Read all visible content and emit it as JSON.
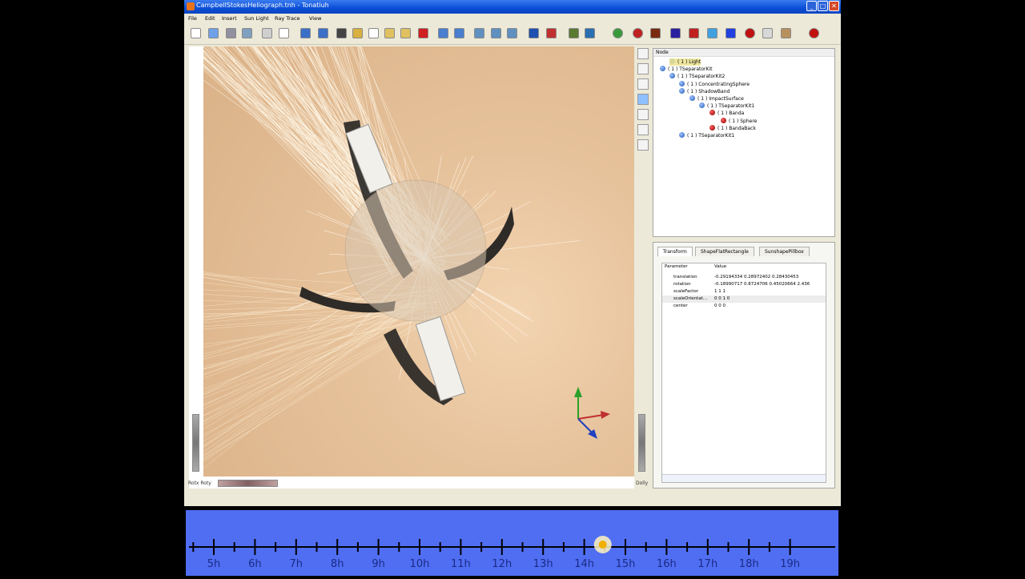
{
  "window": {
    "title": "CampbellStokesHeliograph.tnh - Tonatiuh"
  },
  "menu": [
    "File",
    "Edit",
    "Insert",
    "Sun Light",
    "Ray Trace",
    "View"
  ],
  "toolbar": {
    "icons": [
      "new-file-icon",
      "open-file-icon",
      "save-icon",
      "save-as-icon",
      "print-icon",
      "close-doc-icon",
      "undo-icon",
      "redo-icon",
      "arrow-down-icon",
      "cut-icon",
      "copy-icon",
      "paste-icon",
      "paste-link-icon",
      "delete-icon",
      "rotate-icon",
      "export-icon",
      "group-node-icon",
      "surface-node-icon",
      "material-node-icon",
      "separator-node-icon",
      "shape-node-icon",
      "tracker-icon",
      "tracker-alt-icon",
      "material-icon",
      "cone-icon",
      "cylinder-icon",
      "flat-rect-icon",
      "disk-icon",
      "parabolic-icon",
      "square-icon",
      "sphere-icon",
      "plane-icon",
      "box-icon",
      "run-ray-trace-icon"
    ]
  },
  "viewer": {
    "left_wheel_label": "Rotx Roty",
    "right_wheel_label": "Dolly"
  },
  "tree": {
    "header": "Node",
    "nodes": [
      {
        "label": "( 1 )  Light",
        "icon": "light"
      },
      {
        "label": "( 1 )  TSeparatorKit",
        "icon": "separator"
      },
      {
        "label": "( 1 )  TSeparatorKit2",
        "icon": "separator"
      },
      {
        "label": "( 1 )  ConcentratingSphere",
        "icon": "separator"
      },
      {
        "label": "( 1 )  ShadowBand",
        "icon": "separator"
      },
      {
        "label": "( 1 )  ImpactSurface",
        "icon": "separator"
      },
      {
        "label": "( 1 )  TSeparatorKit1",
        "icon": "separator"
      },
      {
        "label": "( 1 )  Banda",
        "icon": "shape"
      },
      {
        "label": "( 1 )  Sphere",
        "icon": "shape"
      },
      {
        "label": "( 1 )  BandaBack",
        "icon": "shape"
      },
      {
        "label": "( 1 )  TSeparatorKit1",
        "icon": "separator"
      }
    ]
  },
  "properties": {
    "tabs": [
      "Transform",
      "ShapeFlatRectangle",
      "SunshapePillbox"
    ],
    "active_tab": "Transform",
    "col_param": "Parameter",
    "col_value": "Value",
    "rows": [
      {
        "name": "translation",
        "value": "-0.29194334 0.28972402 0.28430453"
      },
      {
        "name": "rotation",
        "value": "-0.18990717 0.8724706 0.45020664  2.436"
      },
      {
        "name": "scaleFactor",
        "value": "1 1 1"
      },
      {
        "name": "scaleOrientat...",
        "value": "0 0 1  0"
      },
      {
        "name": "center",
        "value": "0 0 0"
      }
    ]
  },
  "timeline": {
    "hours": [
      "5h",
      "6h",
      "7h",
      "8h",
      "9h",
      "10h",
      "11h",
      "12h",
      "13h",
      "14h",
      "15h",
      "16h",
      "17h",
      "18h",
      "19h"
    ],
    "sun_position_hour": 14.45,
    "color": "#4f6ef2"
  },
  "colors": {
    "titlebar": "#0a4fd6",
    "accent_blue": "#4f6ef2",
    "tree_selected": "#efe7a0"
  }
}
